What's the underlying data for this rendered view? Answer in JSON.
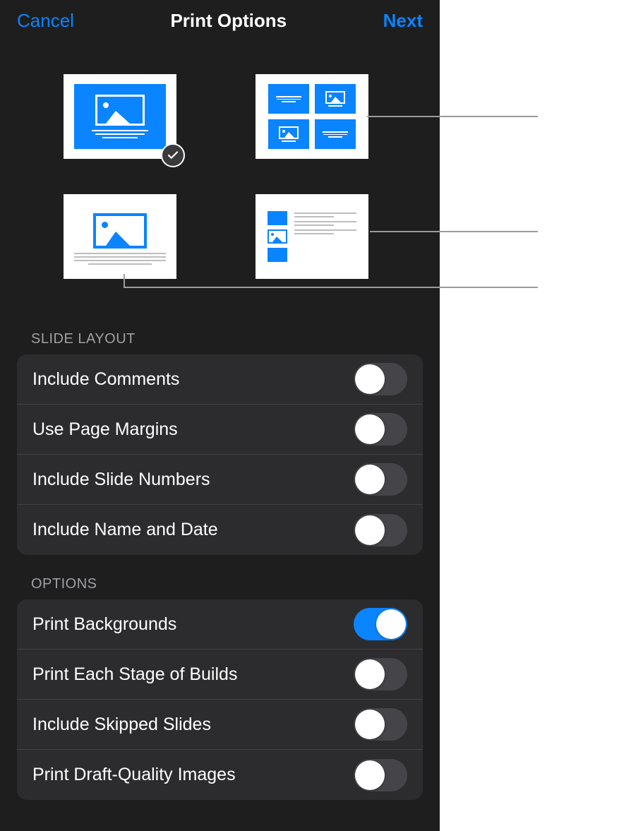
{
  "header": {
    "cancel_label": "Cancel",
    "title": "Print Options",
    "next_label": "Next"
  },
  "layouts": {
    "selected_index": 0,
    "items": [
      {
        "name": "slide-layout"
      },
      {
        "name": "grid-layout"
      },
      {
        "name": "handout-layout"
      },
      {
        "name": "outline-layout"
      }
    ]
  },
  "sections": {
    "slide_layout": {
      "header": "SLIDE LAYOUT",
      "rows": [
        {
          "label": "Include Comments",
          "on": false
        },
        {
          "label": "Use Page Margins",
          "on": false
        },
        {
          "label": "Include Slide Numbers",
          "on": false
        },
        {
          "label": "Include Name and Date",
          "on": false
        }
      ]
    },
    "options": {
      "header": "OPTIONS",
      "rows": [
        {
          "label": "Print Backgrounds",
          "on": true
        },
        {
          "label": "Print Each Stage of Builds",
          "on": false
        },
        {
          "label": "Include Skipped Slides",
          "on": false
        },
        {
          "label": "Print Draft-Quality Images",
          "on": false
        }
      ]
    }
  },
  "colors": {
    "accent": "#0a84ff",
    "switch_on": "#0a84ff",
    "panel_bg": "#1e1e1e",
    "group_bg": "#2c2c2e"
  }
}
